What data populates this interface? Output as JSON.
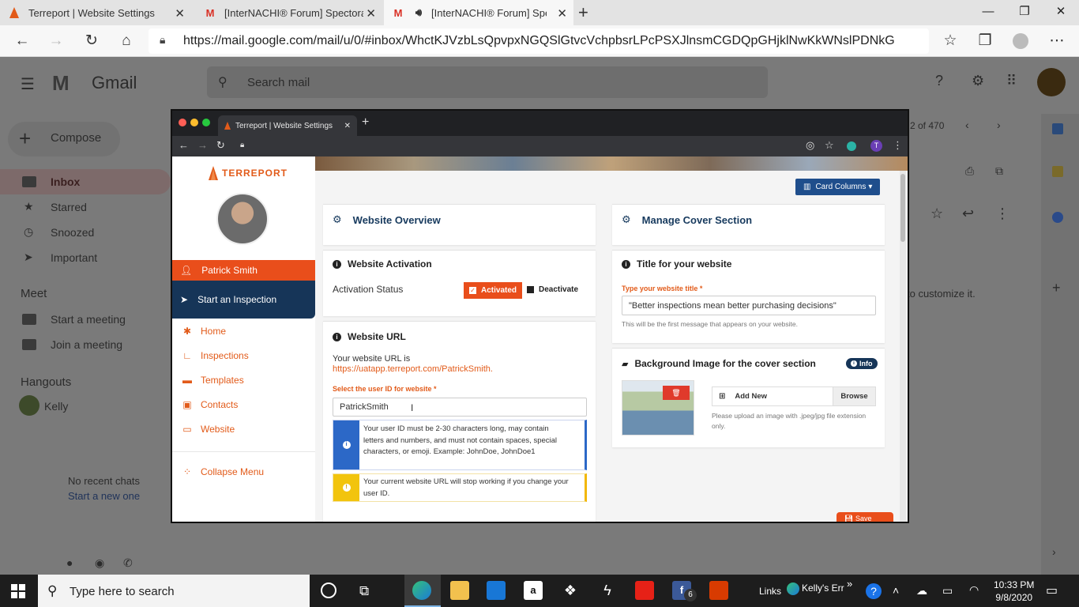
{
  "edge": {
    "tabs": [
      {
        "title": "Terreport | Website Settings",
        "icon": "terreport-logo-icon"
      },
      {
        "title": "[InterNACHI® Forum] Spectora S",
        "icon": "gmail-icon"
      },
      {
        "title": "[InterNACHI® Forum] Spect",
        "icon": "gmail-icon",
        "audio": "speaker-icon"
      }
    ],
    "url": "https://mail.google.com/mail/u/0/#inbox/WhctKJVzbLsQpvpxNGQSlGtvcVchpbsrLPcPSXJlnsmCGDQpGHjklNwKkWNslPDNkG..."
  },
  "gmail": {
    "app_name": "Gmail",
    "search_placeholder": "Search mail",
    "compose": "Compose",
    "nav": [
      "Inbox",
      "Starred",
      "Snoozed",
      "Important"
    ],
    "meet_header": "Meet",
    "meet_items": [
      "Start a meeting",
      "Join a meeting"
    ],
    "hangouts_header": "Hangouts",
    "hangouts_user": "Kelly",
    "no_recent": "No recent chats",
    "start_new": "Start a new one",
    "count": "2 of 470",
    "customize_hint": "to customize it."
  },
  "embedded": {
    "tab_title": "Terreport | Website Settings",
    "avatar_letter": "T"
  },
  "terreport": {
    "brand": "TERREPORT",
    "user_name": "Patrick Smith",
    "start_inspection": "Start an Inspection",
    "menu": [
      "Home",
      "Inspections",
      "Templates",
      "Contacts",
      "Website"
    ],
    "collapse": "Collapse Menu",
    "card_columns": "Card Columns",
    "website_overview": "Website Overview",
    "activation": {
      "title": "Website Activation",
      "status_label": "Activation Status",
      "activated": "Activated",
      "deactivate": "Deactivate"
    },
    "website_url": {
      "title": "Website URL",
      "your_url_is": "Your website URL is",
      "url": "https://uatapp.terreport.com/PatrickSmith.",
      "select_label": "Select the user ID for website *",
      "user_id_value": "PatrickSmith",
      "info_msg": "Your user ID must be 2-30 characters long, may contain letters and numbers, and must not contain spaces, special characters, or emoji. Example: JohnDoe, JohnDoe1",
      "warn_msg": "Your current website URL will stop working if you change your user ID."
    },
    "manage_cover": "Manage Cover Section",
    "title_card": {
      "title": "Title for your website",
      "label": "Type your website title *",
      "value": "\"Better inspections mean better purchasing decisions\"",
      "hint": "This will be the first message that appears on your website."
    },
    "bg_card": {
      "title": "Background Image for the cover section",
      "info": "Info",
      "add_new": "Add New",
      "browse": "Browse",
      "hint": "Please upload an image with .jpeg/jpg file extension only."
    },
    "save": "Save"
  },
  "taskbar": {
    "search_placeholder": "Type here to search",
    "links": "Links",
    "kelly": "Kelly's Err",
    "fb_badge": "6",
    "time": "10:33 PM",
    "date": "9/8/2020"
  },
  "colors": {
    "accent": "#e25b1a",
    "navy": "#173a5e",
    "card_btn": "#1f4e8c"
  }
}
